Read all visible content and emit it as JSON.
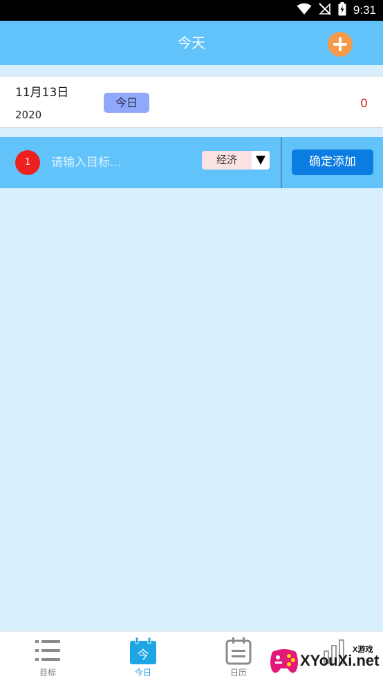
{
  "status_bar": {
    "time": "9:31",
    "icons": [
      "wifi-icon",
      "no-signal-icon",
      "battery-charging-icon"
    ]
  },
  "app_bar": {
    "title": "今天",
    "add_icon": "plus-circle-icon",
    "accent_color": "#f59a4a"
  },
  "date_card": {
    "month_day": "11月13日",
    "year": "2020",
    "today_badge": "今日",
    "count": "0"
  },
  "input_row": {
    "index": "1",
    "placeholder": "请输入目标...",
    "value": "",
    "category": "经济",
    "confirm_label": "确定添加"
  },
  "bottom_nav": {
    "items": [
      {
        "label": "目标",
        "icon": "list-icon",
        "active": false
      },
      {
        "label": "今日",
        "icon": "calendar-today-icon",
        "icon_text": "今",
        "active": true
      },
      {
        "label": "日历",
        "icon": "calendar-icon",
        "active": false
      },
      {
        "label": "",
        "icon": "chart-icon",
        "active": false
      }
    ]
  },
  "watermark": {
    "small_text": "X游戏",
    "brand_text": "XYouXi.net"
  },
  "colors": {
    "primary": "#62c3fb",
    "background": "#d8effe",
    "confirm_button": "#0a7ce2",
    "badge": "#ee2121",
    "today_badge": "#90a8fa",
    "active_nav": "#1e9ae0"
  }
}
